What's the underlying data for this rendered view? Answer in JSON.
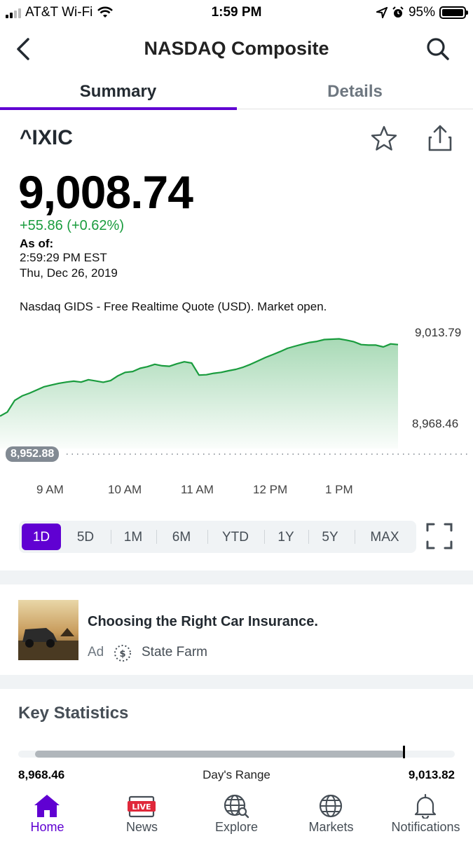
{
  "status_bar": {
    "carrier": "AT&T Wi-Fi",
    "time": "1:59 PM",
    "battery": "95%",
    "icons": [
      "signal-icon",
      "wifi-icon",
      "location-icon",
      "alarm-icon",
      "battery-icon"
    ]
  },
  "nav": {
    "title": "NASDAQ Composite",
    "icons": [
      "back-chevron-icon",
      "search-icon"
    ]
  },
  "tabs": [
    {
      "label": "Summary",
      "active": true
    },
    {
      "label": "Details",
      "active": false
    }
  ],
  "quote": {
    "symbol": "^IXIC",
    "price": "9,008.74",
    "change": "+55.86 (+0.62%)",
    "as_of_label": "As of:",
    "as_of_time": "2:59:29 PM EST",
    "as_of_date": "Thu, Dec 26, 2019",
    "market_note": "Nasdaq GIDS - Free Realtime Quote (USD). Market open.",
    "change_color": "#1a9c3e"
  },
  "chart_data": {
    "type": "area",
    "y_high_label": "9,013.79",
    "y_low_label": "8,968.46",
    "previous_close_label": "8,952.88",
    "x_ticks": [
      "9 AM",
      "10 AM",
      "11 AM",
      "12 PM",
      "1 PM"
    ],
    "line_color": "#1a9c3e",
    "values": [
      8970.5,
      8972.8,
      8979.3,
      8981.8,
      8983.3,
      8985.1,
      8986.9,
      8987.9,
      8988.8,
      8989.5,
      8990.0,
      8989.5,
      8990.8,
      8990.1,
      8989.4,
      8990.3,
      8993.0,
      8994.9,
      8995.4,
      8997.2,
      8998.1,
      8999.4,
      8998.6,
      8998.3,
      8999.7,
      9000.8,
      9000.1,
      8993.4,
      8993.6,
      8994.4,
      8994.9,
      8995.8,
      8996.6,
      8997.8,
      8999.4,
      9001.3,
      9003.2,
      9004.8,
      9006.5,
      9008.3,
      9009.5,
      9010.6,
      9011.6,
      9012.2,
      9013.2,
      9013.4,
      9013.6,
      9012.9,
      9012.0,
      9010.4,
      9010.1,
      9010.1,
      9009.1,
      9010.8,
      9010.4
    ]
  },
  "range_selector": {
    "options": [
      "1D",
      "5D",
      "1M",
      "6M",
      "YTD",
      "1Y",
      "5Y",
      "MAX"
    ],
    "selected": "1D",
    "accent": "#6001d2"
  },
  "ad": {
    "title": "Choosing the Right Car Insurance.",
    "label": "Ad",
    "sponsor": "State Farm"
  },
  "key_statistics": {
    "title": "Key Statistics",
    "days_range_low": "8,968.46",
    "days_range_label": "Day's Range",
    "days_range_high": "9,013.82",
    "position_fraction": 0.89
  },
  "tabbar": {
    "items": [
      {
        "label": "Home",
        "icon": "home-icon",
        "active": true
      },
      {
        "label": "News",
        "icon": "live-news-icon",
        "active": false
      },
      {
        "label": "Explore",
        "icon": "explore-globe-icon",
        "active": false
      },
      {
        "label": "Markets",
        "icon": "markets-globe-icon",
        "active": false
      },
      {
        "label": "Notifications",
        "icon": "bell-icon",
        "active": false
      }
    ],
    "accent": "#6001d2"
  }
}
